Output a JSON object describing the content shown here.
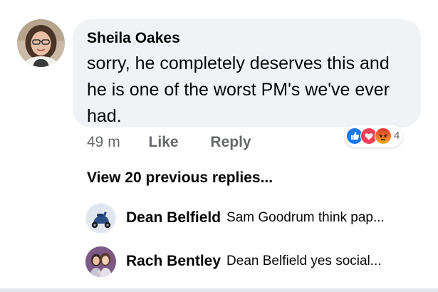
{
  "comment": {
    "author": "Sheila Oakes",
    "text": "sorry, he completely deserves this and he is one of the worst PM's we've ever had.",
    "time": "49 m",
    "like_label": "Like",
    "reply_label": "Reply",
    "reactions": {
      "icons": [
        "like-icon",
        "love-icon",
        "angry-icon"
      ],
      "count": "4",
      "colors": {
        "like": "#1877f2",
        "love": "#f33e58",
        "angry": "#e9710f"
      }
    }
  },
  "view_previous_label": "View 20 previous replies...",
  "replies": [
    {
      "author": "Dean Belfield",
      "snippet": "Sam Goodrum think pap..."
    },
    {
      "author": "Rach Bentley",
      "snippet": "Dean Belfield yes social..."
    }
  ]
}
